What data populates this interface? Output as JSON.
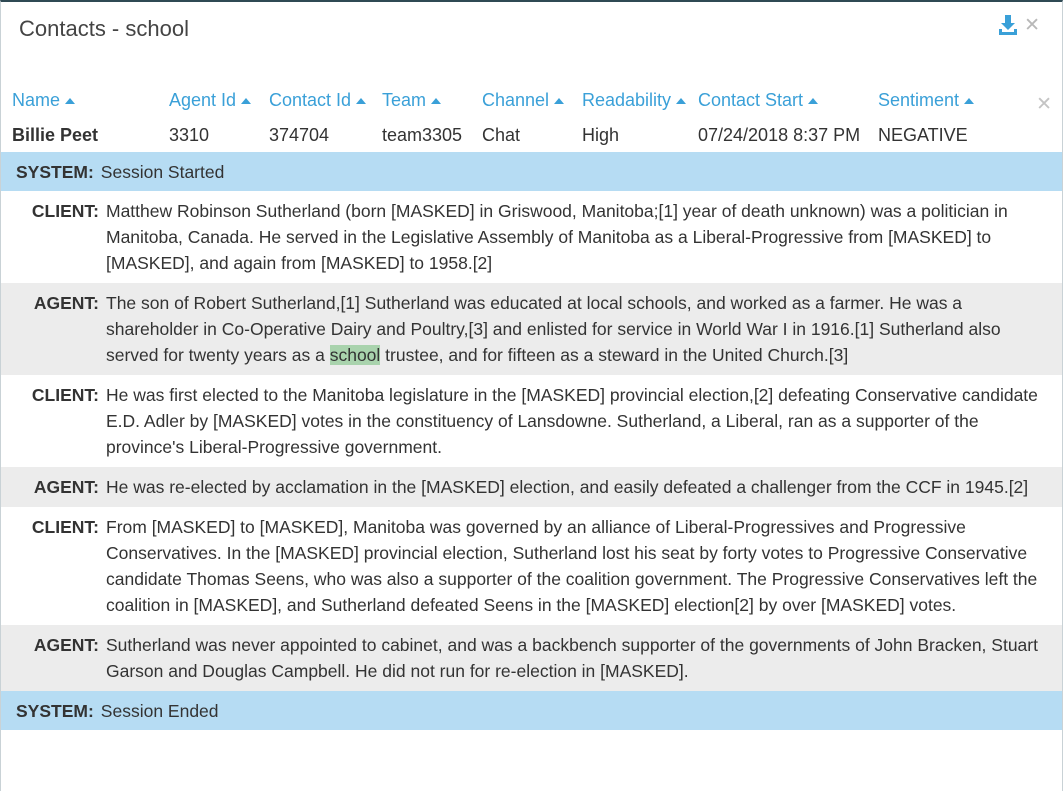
{
  "window": {
    "title": "Contacts - school"
  },
  "columns": [
    {
      "key": "name",
      "label": "Name"
    },
    {
      "key": "agent_id",
      "label": "Agent Id"
    },
    {
      "key": "contact_id",
      "label": "Contact Id"
    },
    {
      "key": "team",
      "label": "Team"
    },
    {
      "key": "channel",
      "label": "Channel"
    },
    {
      "key": "readability",
      "label": "Readability"
    },
    {
      "key": "contact_start",
      "label": "Contact Start"
    },
    {
      "key": "sentiment",
      "label": "Sentiment"
    }
  ],
  "contact": {
    "name": "Billie Peet",
    "agent_id": "3310",
    "contact_id": "374704",
    "team": "team3305",
    "channel": "Chat",
    "readability": "High",
    "contact_start": "07/24/2018 8:37 PM",
    "sentiment": "NEGATIVE"
  },
  "icons": {
    "download": "download-icon",
    "close": "close-icon"
  },
  "colors": {
    "accent": "#3aa0d8",
    "system_bg": "#b6dcf3",
    "agent_bg": "#ececec",
    "highlight": "#a9d3ad"
  },
  "transcript": [
    {
      "speaker": "SYSTEM:",
      "text": "Session Started"
    },
    {
      "speaker": "CLIENT:",
      "text": "Matthew Robinson Sutherland (born [MASKED] in Griswood, Manitoba;[1] year of death unknown) was a politician in Manitoba, Canada. He served in the Legislative Assembly of Manitoba as a Liberal-Progressive from [MASKED] to [MASKED], and again from [MASKED] to 1958.[2]"
    },
    {
      "speaker": "AGENT:",
      "text_before": "The son of Robert Sutherland,[1] Sutherland was educated at local schools, and worked as a farmer. He was a shareholder in Co-Operative Dairy and Poultry,[3] and enlisted for service in World War I in 1916.[1] Sutherland also served for twenty years as a ",
      "highlight": "school",
      "text_after": " trustee, and for fifteen as a steward in the United Church.[3]"
    },
    {
      "speaker": "CLIENT:",
      "text": "He was first elected to the Manitoba legislature in the [MASKED] provincial election,[2] defeating Conservative candidate E.D. Adler by [MASKED] votes in the constituency of Lansdowne. Sutherland, a Liberal, ran as a supporter of the province's Liberal-Progressive government."
    },
    {
      "speaker": "AGENT:",
      "text": "He was re-elected by acclamation in the [MASKED] election, and easily defeated a challenger from the CCF in 1945.[2]"
    },
    {
      "speaker": "CLIENT:",
      "text": "From [MASKED] to [MASKED], Manitoba was governed by an alliance of Liberal-Progressives and Progressive Conservatives. In the [MASKED] provincial election, Sutherland lost his seat by forty votes to Progressive Conservative candidate Thomas Seens, who was also a supporter of the coalition government. The Progressive Conservatives left the coalition in [MASKED], and Sutherland defeated Seens in the [MASKED] election[2] by over [MASKED] votes."
    },
    {
      "speaker": "AGENT:",
      "text": "Sutherland was never appointed to cabinet, and was a backbench supporter of the governments of John Bracken, Stuart Garson and Douglas Campbell. He did not run for re-election in [MASKED]."
    },
    {
      "speaker": "SYSTEM:",
      "text": "Session Ended"
    }
  ]
}
